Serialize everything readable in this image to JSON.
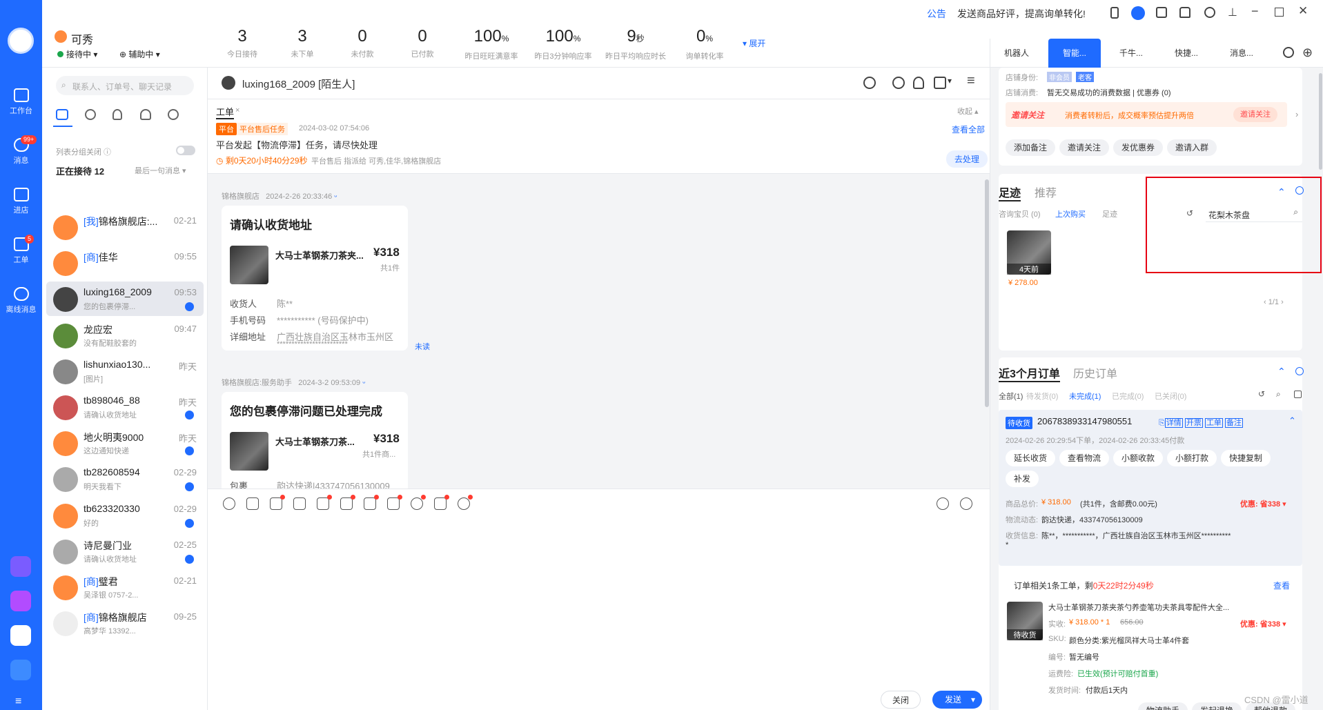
{
  "colors": {
    "brand": "#1f6bff",
    "alert": "#ff3b30",
    "price": "#ff6a00"
  },
  "topbar": {
    "notice_label": "公告",
    "notice_text": "发送商品好评，提高询单转化!",
    "user_name": "可秀",
    "status_label": "接待中",
    "assist_label": "辅助中",
    "expand_label": "展开",
    "stats": [
      {
        "value": "3",
        "unit": "",
        "label": "今日接待"
      },
      {
        "value": "3",
        "unit": "",
        "label": "未下单"
      },
      {
        "value": "0",
        "unit": "",
        "label": "未付款"
      },
      {
        "value": "0",
        "unit": "",
        "label": "已付款"
      },
      {
        "value": "100",
        "unit": "%",
        "label": "昨日旺旺满意率"
      },
      {
        "value": "100",
        "unit": "%",
        "label": "昨日3分钟响应率"
      },
      {
        "value": "9",
        "unit": "秒",
        "label": "昨日平均响应时长"
      },
      {
        "value": "0",
        "unit": "%",
        "label": "询单转化率"
      }
    ]
  },
  "rail": {
    "items": [
      {
        "label": "工作台",
        "icon": "workbench-icon",
        "badge": ""
      },
      {
        "label": "消息",
        "icon": "message-icon",
        "badge": "99+"
      },
      {
        "label": "进店",
        "icon": "store-icon",
        "badge": ""
      },
      {
        "label": "工单",
        "icon": "workorder-icon",
        "badge": "5"
      },
      {
        "label": "离线消息",
        "icon": "offline-message-icon",
        "badge": ""
      }
    ]
  },
  "sessions": {
    "search_placeholder": "联系人、订单号、聊天记录",
    "group_toggle_label": "列表分组关闭",
    "receiving_label": "正在接待 12",
    "sort_label": "最后一句消息",
    "items": [
      {
        "tag": "[我]",
        "name": "锦格旗舰店:...",
        "time": "02-21",
        "preview": "",
        "unread": false
      },
      {
        "tag": "[商]",
        "name": "佳华",
        "time": "09:55",
        "preview": "",
        "unread": false
      },
      {
        "tag": "",
        "name": "luxing168_2009",
        "time": "09:53",
        "preview": "您的包裹停滞...",
        "unread": true
      },
      {
        "tag": "",
        "name": "龙应宏",
        "time": "09:47",
        "preview": "没有配鞋胶套的",
        "unread": false
      },
      {
        "tag": "",
        "name": "lishunxiao130...",
        "time": "昨天",
        "preview": "[图片]",
        "unread": false
      },
      {
        "tag": "",
        "name": "tb898046_88",
        "time": "昨天",
        "preview": "请确认收货地址",
        "unread": true
      },
      {
        "tag": "",
        "name": "地火明夷9000",
        "time": "昨天",
        "preview": "这边通知快递",
        "unread": true
      },
      {
        "tag": "",
        "name": "tb282608594",
        "time": "02-29",
        "preview": "明天我看下",
        "unread": true
      },
      {
        "tag": "",
        "name": "tb623320330",
        "time": "02-29",
        "preview": "好的",
        "unread": true
      },
      {
        "tag": "",
        "name": "诗尼曼门业",
        "time": "02-25",
        "preview": "请确认收货地址",
        "unread": true
      },
      {
        "tag": "[商]",
        "name": "璧君",
        "time": "02-21",
        "preview": "吴泽银 0757-2...",
        "unread": false
      },
      {
        "tag": "[商]",
        "name": "锦格旗舰店",
        "time": "09-25",
        "preview": "高梦华 13392...",
        "unread": false
      }
    ]
  },
  "chat": {
    "contact": "luxing168_2009",
    "contact_tag": "[陌生人]",
    "workorder": {
      "tab": "工单",
      "collapse": "收起",
      "badge": "平台",
      "type": "平台售后任务",
      "time": "2024-03-02 07:54:06",
      "view_all": "查看全部",
      "desc": "平台发起【物流停滞】任务，请尽快处理",
      "remain": "剩0天20小时40分29秒",
      "assign": "平台售后 指派给 可秀,佳华,锦格旗舰店",
      "action": "去处理"
    },
    "messages": [
      {
        "sender": "锦格旗舰店",
        "time": "2024-2-26 20:33:46",
        "title": "请确认收货地址",
        "product": "大马士革钢茶刀茶夹...",
        "price": "¥318",
        "qty": "共1件",
        "rows": [
          {
            "k": "收货人",
            "v": "陈**"
          },
          {
            "k": "手机号码",
            "v": "*********** (号码保护中)"
          },
          {
            "k": "详细地址",
            "v": "广西壮族自治区玉林市玉州区"
          },
          {
            "k": "",
            "v": "************************"
          }
        ],
        "status": "未读"
      },
      {
        "sender": "锦格旗舰店:服务助手",
        "time": "2024-3-2 09:53:09",
        "title": "您的包裹停滞问题已处理完成",
        "product": "大马士革钢茶刀茶...",
        "price": "¥318",
        "qty": "共1件商...",
        "rows": [
          {
            "k": "包裹",
            "v": "韵达快递|433747056130009"
          }
        ]
      }
    ],
    "close_label": "关闭",
    "send_label": "发送"
  },
  "right": {
    "tabs": [
      "机器人",
      "智能...",
      "千牛...",
      "快捷...",
      "消息..."
    ],
    "customer": {
      "identity_label": "店铺身份:",
      "identity_tag1": "非会员",
      "identity_tag2": "老客",
      "consume_label": "店铺消费:",
      "consume_text": "暂无交易成功的消费数据",
      "coupon_text": "| 优惠券 (0)"
    },
    "invite": {
      "tag": "邀请关注",
      "text": "消费者转粉后，成交概率预估提升两倍",
      "button": "邀请关注"
    },
    "action_pills": [
      "添加备注",
      "邀请关注",
      "发优惠券",
      "邀请入群"
    ],
    "footprint": {
      "tab1": "足迹",
      "tab2": "推荐",
      "sub": [
        "咨询宝贝 (0)",
        "上次购买",
        "足迹"
      ],
      "search_value": "花梨木茶盘",
      "item_label": "4天前",
      "item_price": "¥ 278.00",
      "pager": "1/1"
    },
    "orders": {
      "tab1": "近3个月订单",
      "tab2": "历史订单",
      "filters": [
        "全部(1)",
        "待发货(0)",
        "未完成(1)",
        "已完成(0)",
        "已关闭(0)"
      ],
      "status": "待收货",
      "order_no": "2067838933147980551",
      "links": [
        "详情",
        "开票",
        "工单",
        "备注"
      ],
      "times": "2024-02-26 20:29:54下单，2024-02-26 20:33:45付款",
      "ops": [
        "延长收货",
        "查看物流",
        "小额收款",
        "小额打款",
        "快捷复制",
        "补发"
      ],
      "total_label": "商品总价:",
      "total_value": "¥ 318.00",
      "total_note": "(共1件，含邮费0.00元)",
      "discount": "优惠: 省338",
      "logistics_label": "物流动态:",
      "logistics_value": "韵达快递，433747056130009",
      "receiver_label": "收货信息:",
      "receiver_value": "陈**，***********，广西壮族自治区玉林市玉州区**********",
      "receiver_more": "*"
    },
    "ticket": {
      "text": "订单相关1条工单，剩",
      "remain": "0天22时2分49秒",
      "view": "查看",
      "product_title": "大马士革钢茶刀茶夹茶勺养壶笔功夫茶具零配件大全...",
      "paid_label": "实收:",
      "paid": "¥ 318.00 * 1",
      "orig": "656.00",
      "discount": "优惠: 省338",
      "sku_label": "SKU:",
      "sku": "颜色分类:紫光榴凤祥大马士革4件套",
      "code_label": "编号:",
      "code": "暂无编号",
      "insure_label": "运费险:",
      "insure": "已生效(预计可赔付首重)",
      "ship_label": "发货时间:",
      "ship": "付款后1天内",
      "img_label": "待收货",
      "buttons": [
        "物流助手",
        "发起退换",
        "帮他退款"
      ]
    },
    "watermark": "CSDN @雷小道"
  }
}
